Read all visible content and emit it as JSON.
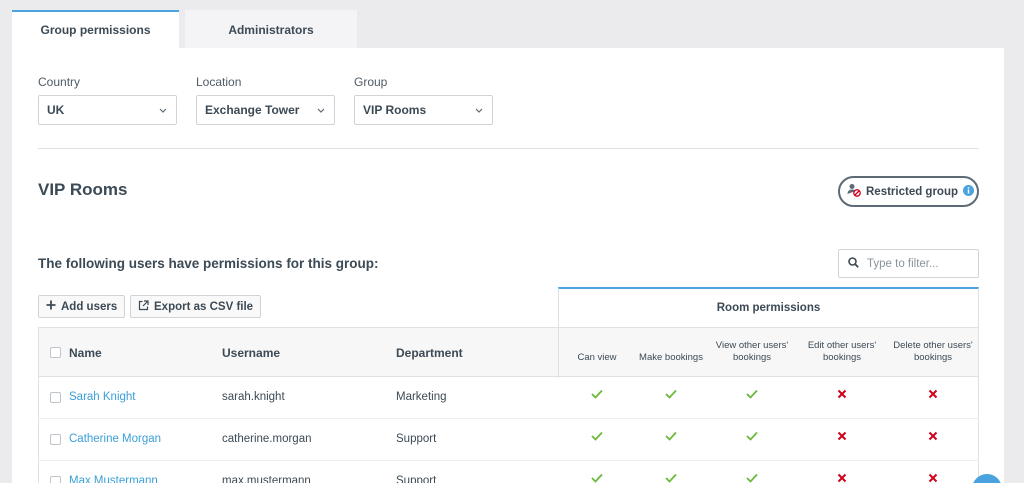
{
  "tabs": [
    {
      "label": "Group permissions",
      "active": true
    },
    {
      "label": "Administrators",
      "active": false
    }
  ],
  "filters": {
    "country": {
      "label": "Country",
      "value": "UK"
    },
    "location": {
      "label": "Location",
      "value": "Exchange Tower"
    },
    "group": {
      "label": "Group",
      "value": "VIP Rooms"
    }
  },
  "group": {
    "title": "VIP Rooms",
    "restricted_label": "Restricted group"
  },
  "users_section": {
    "heading": "The following users have permissions for this group:",
    "filter_placeholder": "Type to filter...",
    "add_users_label": "Add users",
    "export_label": "Export as CSV file"
  },
  "table": {
    "columns": {
      "name": "Name",
      "username": "Username",
      "department": "Department"
    },
    "room_permissions_label": "Room permissions",
    "permission_columns": [
      "Can view",
      "Make bookings",
      "View other users' bookings",
      "Edit other users' bookings",
      "Delete other users' bookings"
    ],
    "rows": [
      {
        "name": "Sarah Knight",
        "username": "sarah.knight",
        "department": "Marketing",
        "perms": [
          true,
          true,
          true,
          false,
          false
        ]
      },
      {
        "name": "Catherine Morgan",
        "username": "catherine.morgan",
        "department": "Support",
        "perms": [
          true,
          true,
          true,
          false,
          false
        ]
      },
      {
        "name": "Max Mustermann",
        "username": "max.mustermann",
        "department": "Support",
        "perms": [
          true,
          true,
          true,
          false,
          false
        ]
      }
    ]
  },
  "colors": {
    "accent": "#4aa3df",
    "allowed": "#6bb93a",
    "denied": "#d0021b",
    "link": "#3a9fd8"
  },
  "icons": {
    "allowed": "check-icon",
    "denied": "cross-icon"
  }
}
